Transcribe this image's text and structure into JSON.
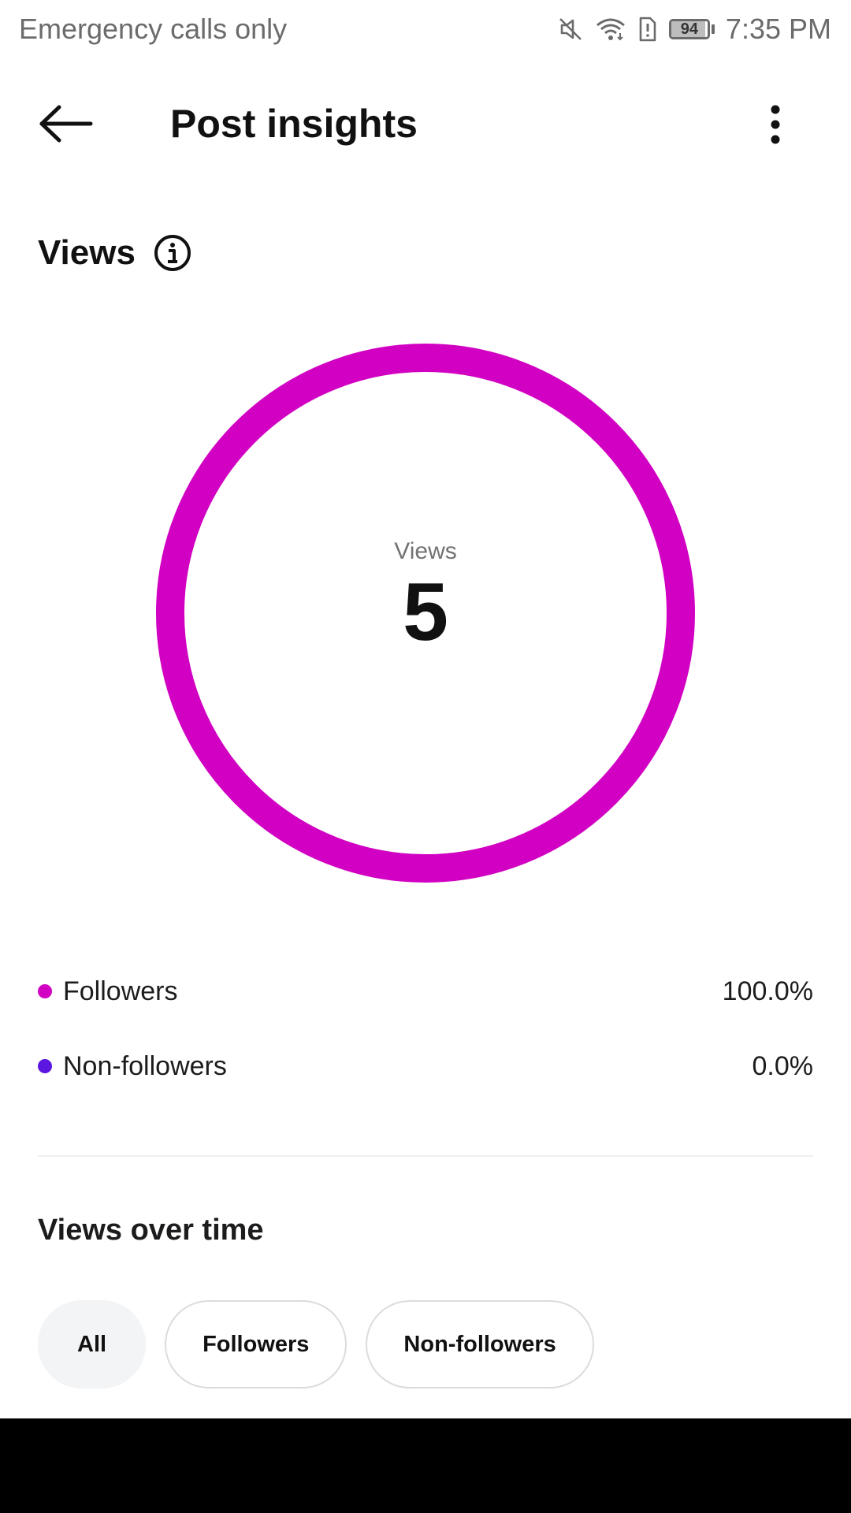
{
  "status_bar": {
    "carrier_text": "Emergency calls only",
    "time": "7:35 PM",
    "battery_level": "94",
    "battery_fraction": 0.94,
    "icons": [
      "mute-icon",
      "wifi-icon",
      "sim-alert-icon",
      "battery-icon"
    ]
  },
  "header": {
    "title": "Post insights",
    "back_icon": "arrow-left-icon",
    "more_icon": "more-vertical-icon"
  },
  "views": {
    "section_title": "Views",
    "info_icon": "info-icon",
    "center_label": "Views",
    "total": "5"
  },
  "chart_data": {
    "type": "pie",
    "categories": [
      "Followers",
      "Non-followers"
    ],
    "values": [
      100.0,
      0.0
    ],
    "colors": [
      "#d100c2",
      "#5b17e0"
    ],
    "center_label": "Views",
    "center_value": 5
  },
  "legend": [
    {
      "label": "Followers",
      "value": "100.0%",
      "color": "#d100c2"
    },
    {
      "label": "Non-followers",
      "value": "0.0%",
      "color": "#5b17e0"
    }
  ],
  "views_over_time": {
    "title": "Views over time",
    "filters": [
      {
        "label": "All",
        "selected": true
      },
      {
        "label": "Followers",
        "selected": false
      },
      {
        "label": "Non-followers",
        "selected": false
      }
    ]
  },
  "colors": {
    "followers": "#d100c2",
    "non_followers": "#5b17e0",
    "chip_selected_bg": "#f3f4f6"
  }
}
